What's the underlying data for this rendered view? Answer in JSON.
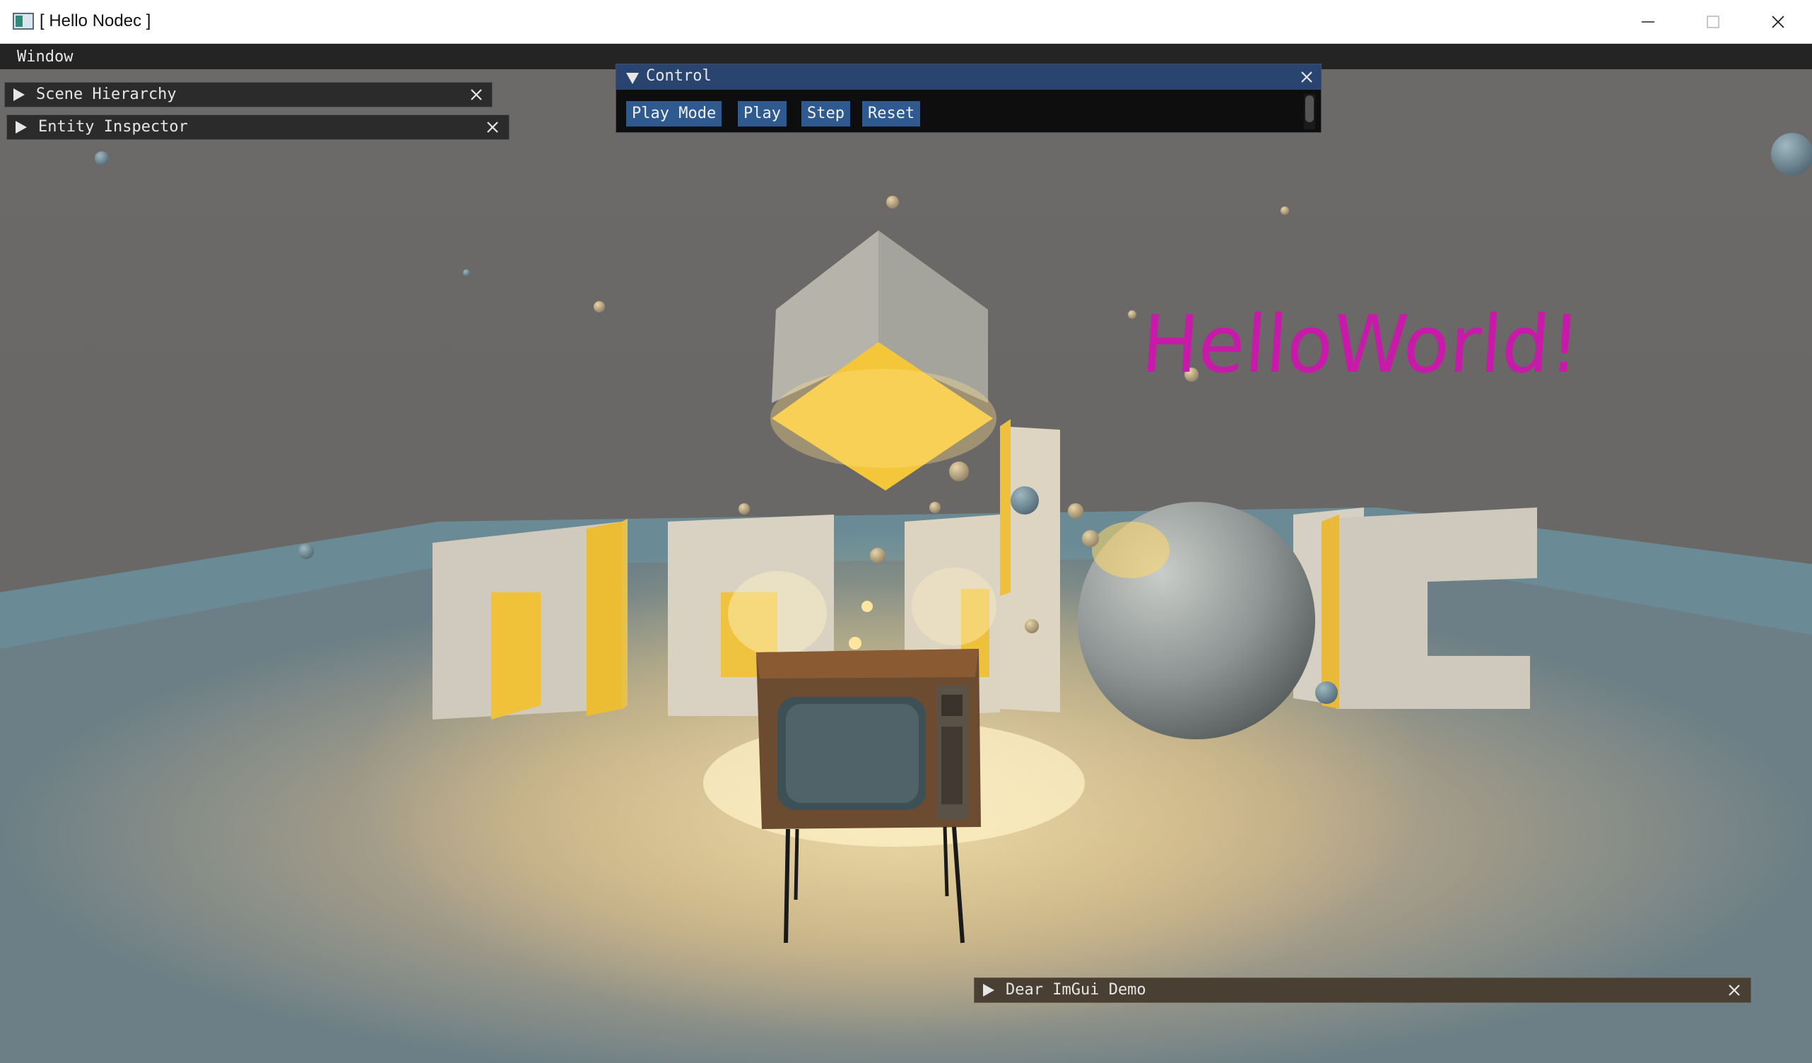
{
  "window": {
    "title": "[ Hello Nodec ]",
    "minimize_icon": "minimize-icon",
    "maximize_icon": "maximize-icon",
    "close_icon": "close-icon"
  },
  "menubar": {
    "items": [
      {
        "label": "Window"
      }
    ]
  },
  "panels": {
    "scene_hierarchy": {
      "title": "Scene Hierarchy",
      "collapsed": true
    },
    "entity_inspector": {
      "title": "Entity Inspector",
      "collapsed": true
    },
    "control": {
      "title": "Control",
      "buttons": {
        "play_mode": "Play Mode",
        "play": "Play",
        "step": "Step",
        "reset": "Reset"
      }
    },
    "imgui_demo": {
      "title": "Dear ImGui Demo",
      "collapsed": true
    }
  },
  "scene": {
    "hello_text": "HelloWorld!",
    "hello_color": "#c81aa8",
    "block_color": "#c9c3b8",
    "glow_color": "#f2c23c",
    "floor_color": "#5d8a9c"
  },
  "colors": {
    "menubar": "#242424",
    "title_active": "#2a4470",
    "button": "#2e5a90"
  }
}
